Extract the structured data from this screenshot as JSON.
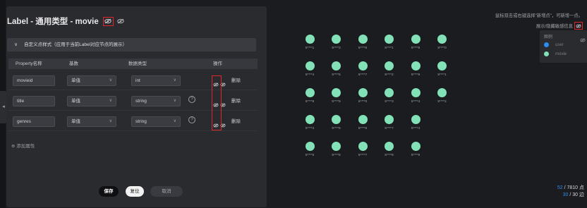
{
  "dialog": {
    "title": "Label - 通用类型 - movie",
    "section_title": "自定义点样式（应用于当前Label对应节点的展示）",
    "table": {
      "headers": [
        "Property名称",
        "基数",
        "数据类型",
        "操作"
      ],
      "rows": [
        {
          "name": "movieid",
          "cardinality": "单值",
          "type": "int",
          "has_help": false,
          "delete": "删除"
        },
        {
          "name": "title",
          "cardinality": "单值",
          "type": "string",
          "has_help": true,
          "delete": "删除"
        },
        {
          "name": "genres",
          "cardinality": "单值",
          "type": "string",
          "has_help": true,
          "delete": "删除"
        }
      ]
    },
    "add_property": "⊕ 添加属性",
    "buttons": {
      "save": "保存",
      "reset": "复位",
      "cancel": "取消"
    }
  },
  "graph": {
    "hint_line1": "鼠标双击或右键选择\"新增点\"，可新增一点。",
    "hint_line2": "展示/隐藏敏感信息",
    "legend": {
      "title": "图例",
      "items": [
        {
          "name": "user",
          "color": "#2d8cf0"
        },
        {
          "name": "movie",
          "color": "#82e1b6"
        }
      ]
    },
    "nodes": [
      {
        "row": 0,
        "col": 0,
        "label": "5****1"
      },
      {
        "row": 0,
        "col": 1,
        "label": "5****3"
      },
      {
        "row": 0,
        "col": 2,
        "label": "5****6"
      },
      {
        "row": 0,
        "col": 3,
        "label": "5****1"
      },
      {
        "row": 0,
        "col": 4,
        "label": "5****8"
      },
      {
        "row": 0,
        "col": 5,
        "label": "5****0"
      },
      {
        "row": 1,
        "col": 0,
        "label": "5****4"
      },
      {
        "row": 1,
        "col": 1,
        "label": "5****5"
      },
      {
        "row": 1,
        "col": 2,
        "label": "5****7"
      },
      {
        "row": 1,
        "col": 3,
        "label": "5****2"
      },
      {
        "row": 1,
        "col": 4,
        "label": "5****9"
      },
      {
        "row": 1,
        "col": 5,
        "label": "5****1"
      },
      {
        "row": 2,
        "col": 0,
        "label": "5****8"
      },
      {
        "row": 2,
        "col": 1,
        "label": "5****9"
      },
      {
        "row": 2,
        "col": 2,
        "label": "5****0"
      },
      {
        "row": 2,
        "col": 3,
        "label": "5****3"
      },
      {
        "row": 2,
        "col": 4,
        "label": "5****3"
      },
      {
        "row": 2,
        "col": 5,
        "label": "5****2"
      },
      {
        "row": 3,
        "col": 0,
        "label": "5****4"
      },
      {
        "row": 3,
        "col": 1,
        "label": "5****5"
      },
      {
        "row": 3,
        "col": 2,
        "label": "5****6"
      },
      {
        "row": 3,
        "col": 3,
        "label": "5****7"
      },
      {
        "row": 3,
        "col": 4,
        "label": "5****4"
      },
      {
        "row": 4,
        "col": 0,
        "label": "5****5"
      },
      {
        "row": 4,
        "col": 1,
        "label": "5****6"
      },
      {
        "row": 4,
        "col": 2,
        "label": "5****7"
      },
      {
        "row": 4,
        "col": 3,
        "label": "5****8"
      },
      {
        "row": 4,
        "col": 4,
        "label": "5****9"
      }
    ],
    "stats": {
      "points_shown": "52",
      "points_total": " / 7810 点",
      "edges_shown": "30",
      "edges_total": " / 30 边"
    }
  },
  "colors": {
    "accent_blue": "#2d8cf0",
    "node_green": "#82e1b6",
    "highlight_red": "#e0262b"
  },
  "icons": [
    "eye-slash-icon",
    "eye-icon",
    "close-icon",
    "chevron-down-icon",
    "help-circle-icon",
    "plus-circle-icon",
    "collapse-arrow-icon"
  ]
}
